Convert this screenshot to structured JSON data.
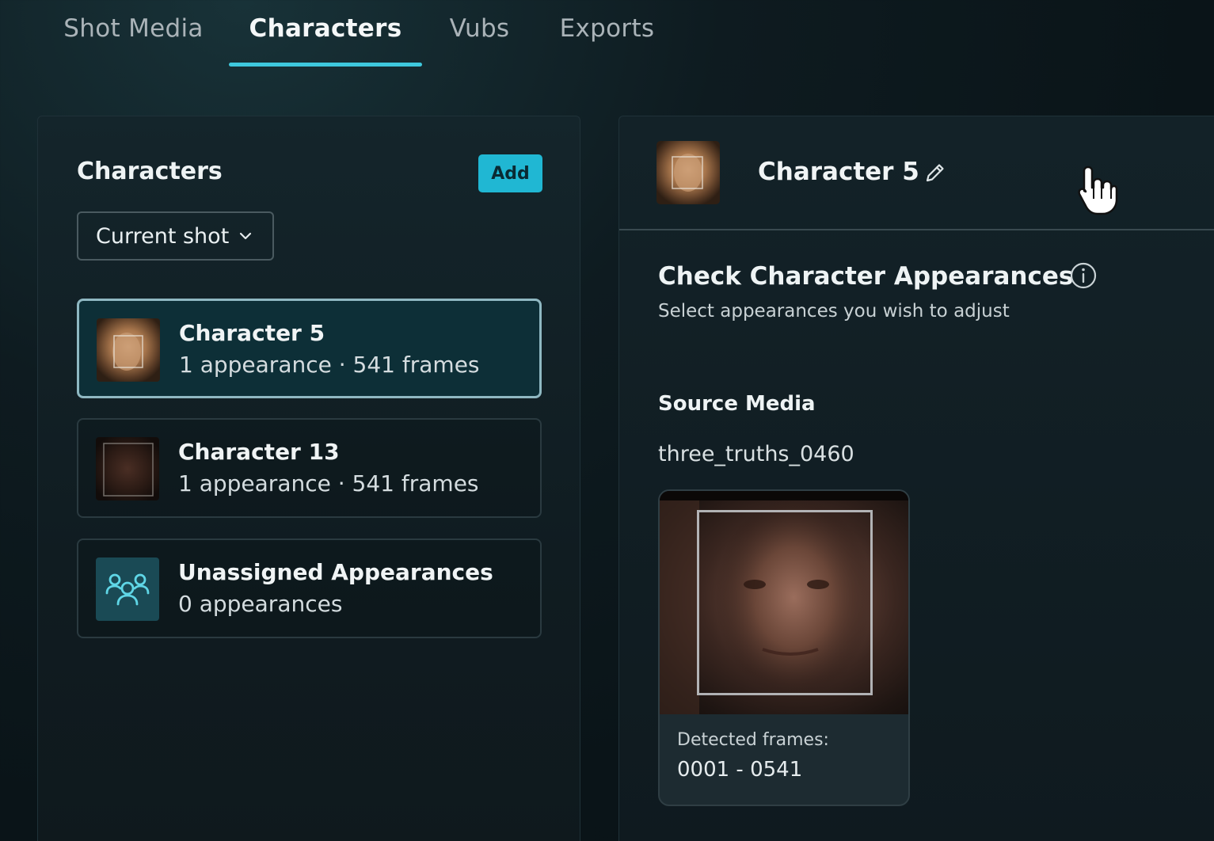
{
  "tabs": [
    {
      "label": "Shot Media",
      "active": false
    },
    {
      "label": "Characters",
      "active": true
    },
    {
      "label": "Vubs",
      "active": false
    },
    {
      "label": "Exports",
      "active": false
    }
  ],
  "left_panel": {
    "title": "Characters",
    "add_label": "Add",
    "filter_value": "Current shot",
    "items": [
      {
        "name": "Character 5",
        "meta": "1 appearance · 541 frames",
        "selected": true
      },
      {
        "name": "Character 13",
        "meta": "1 appearance · 541 frames",
        "selected": false
      },
      {
        "name": "Unassigned Appearances",
        "meta": "0 appearances",
        "selected": false
      }
    ]
  },
  "right_panel": {
    "character_name": "Character 5",
    "check_title": "Check Character Appearances",
    "check_subtitle": "Select appearances you wish to adjust",
    "source_title": "Source Media",
    "source_name": "three_truths_0460",
    "media_card": {
      "label": "Detected frames:",
      "range": "0001 - 0541"
    }
  },
  "colors": {
    "accent": "#3ec8dd",
    "add_button": "#20b7d3",
    "selected_card_bg": "#0d2f37"
  },
  "icons": [
    "chevron-down-icon",
    "pencil-icon",
    "info-icon",
    "group-users-icon",
    "hand-pointer-icon"
  ]
}
